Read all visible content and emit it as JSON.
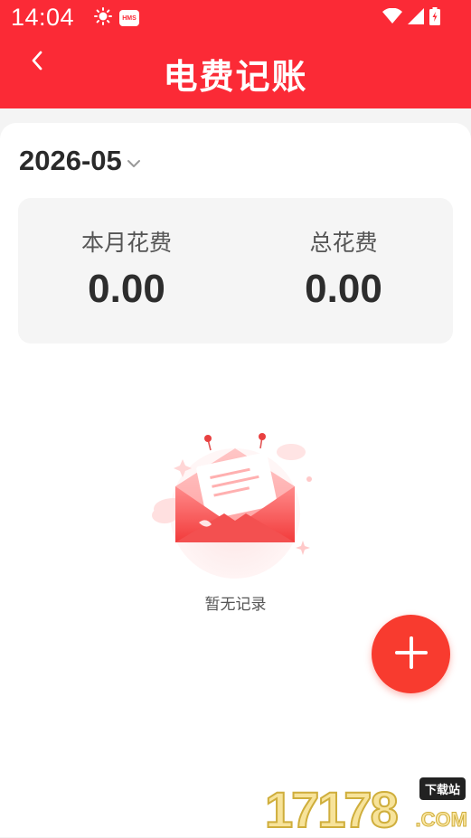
{
  "status_bar": {
    "time": "14:04",
    "left_icons": [
      "sun-icon",
      "hms-icon"
    ],
    "hms_text": "HMS",
    "right_icons": [
      "wifi-icon",
      "signal-icon",
      "battery-icon"
    ]
  },
  "header": {
    "title": "电费记账",
    "back_icon": "chevron-left-icon"
  },
  "month_selector": {
    "value": "2026-05",
    "icon": "chevron-down-icon"
  },
  "summary": {
    "month_spending_label": "本月花费",
    "month_spending_value": "0.00",
    "total_spending_label": "总花费",
    "total_spending_value": "0.00"
  },
  "empty_state": {
    "illustration": "envelope-illustration",
    "text": "暂无记录"
  },
  "fab": {
    "icon": "plus-icon"
  },
  "watermark": {
    "number": "17178",
    "tag": "下载站",
    "domain": ".COM"
  },
  "colors": {
    "brand_red": "#fb2a36",
    "fab_red": "#f83b2f",
    "summary_bg": "#f5f5f5"
  }
}
